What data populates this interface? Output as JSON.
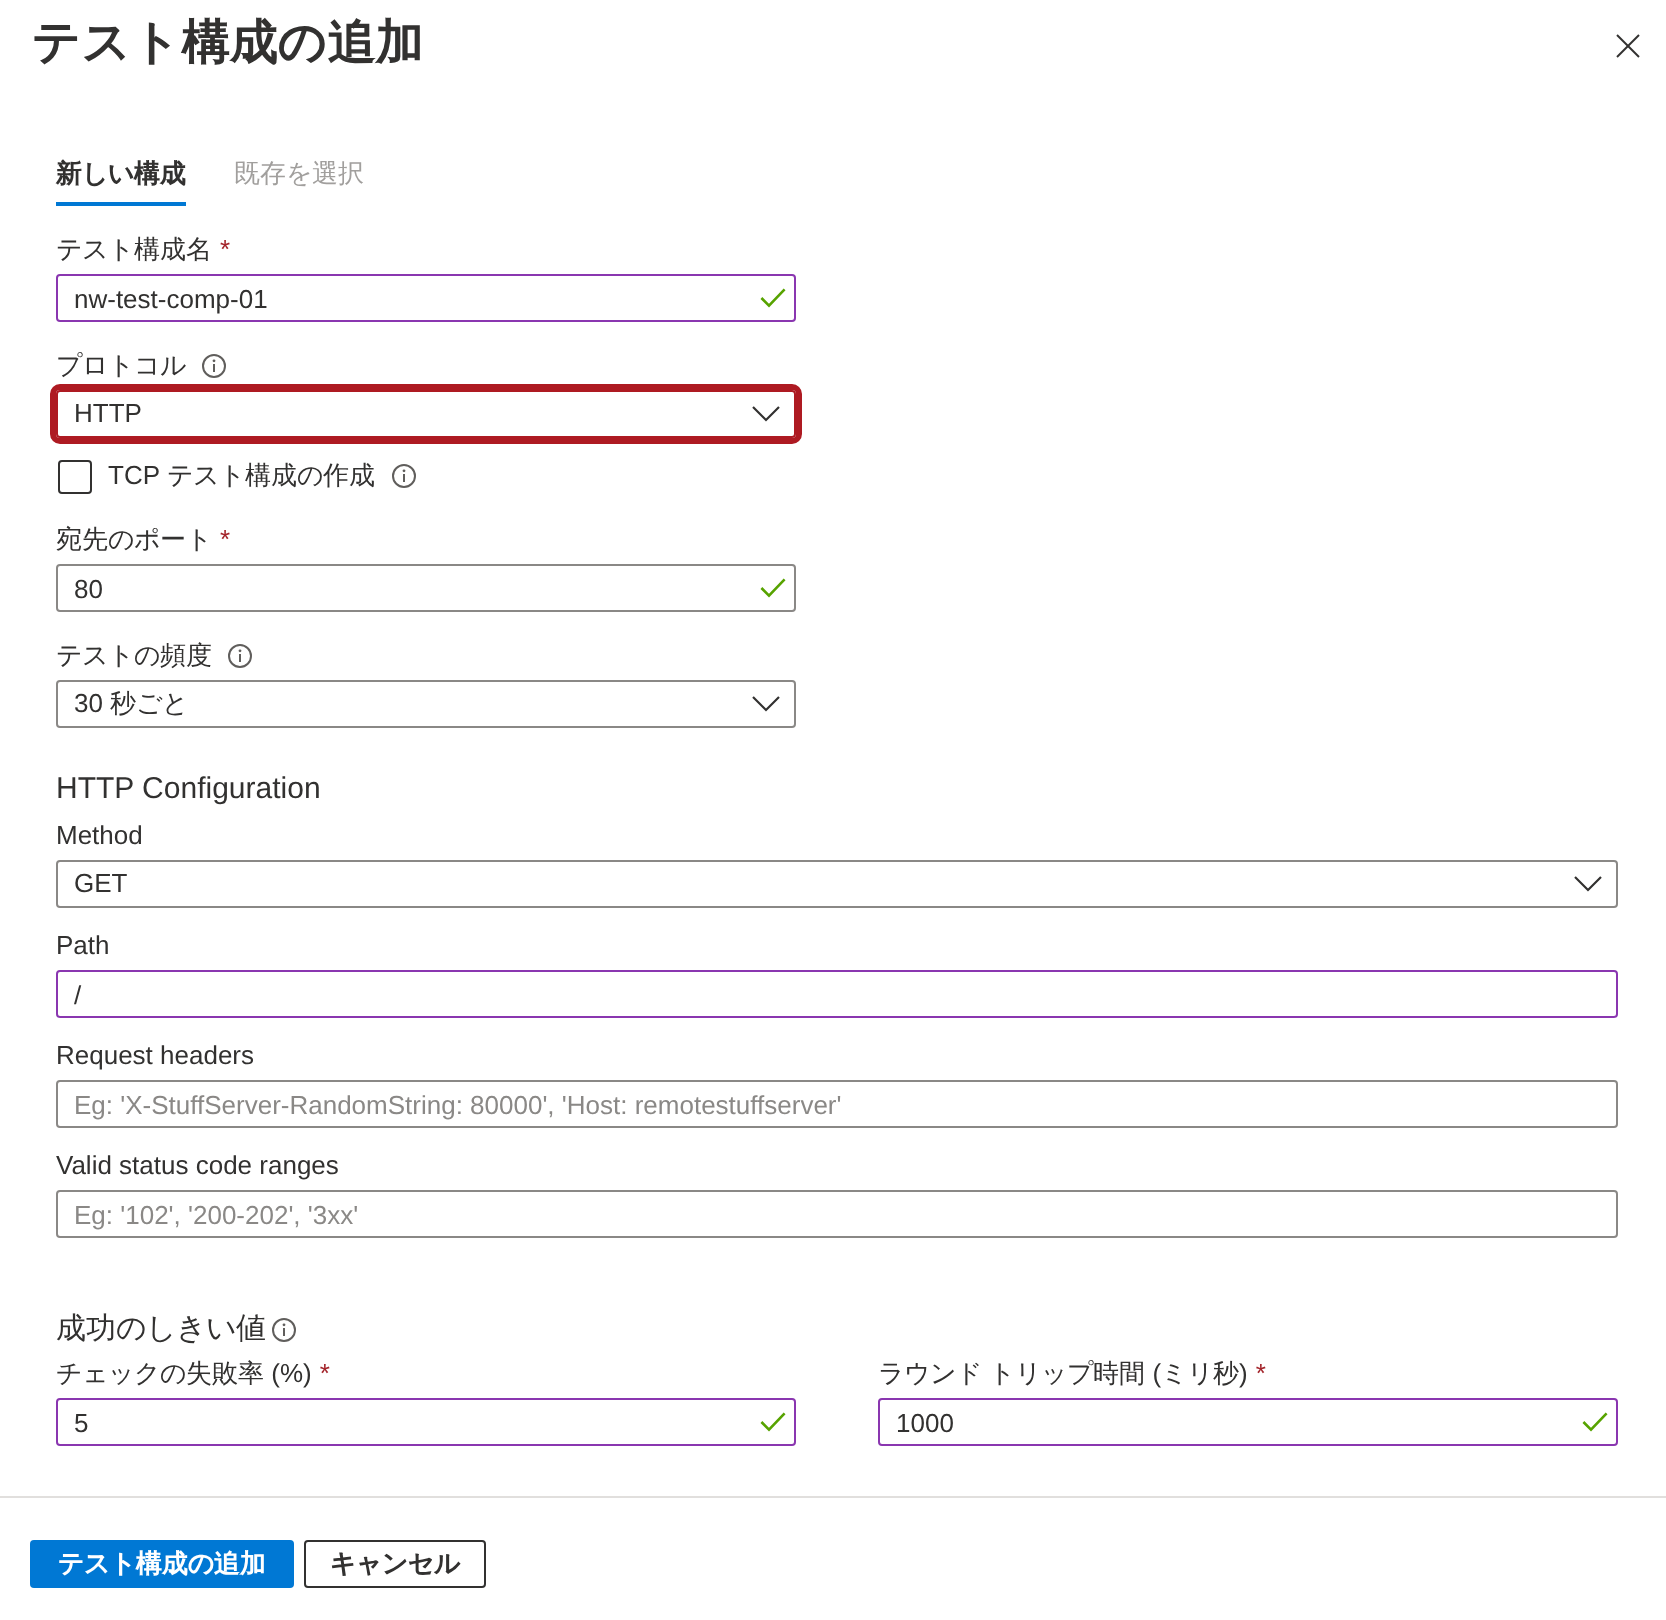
{
  "dialog": {
    "title": "テスト構成の追加"
  },
  "tabs": [
    {
      "label": "新しい構成",
      "selected": true
    },
    {
      "label": "既存を選択",
      "selected": false
    }
  ],
  "fields": [
    {
      "kind": "text",
      "label": "テスト構成名",
      "required_mark": "*",
      "value": "nw-test-comp-01",
      "valid": true,
      "modified": true
    },
    {
      "kind": "select",
      "label": "プロトコル",
      "info": true,
      "value": "HTTP",
      "highlighted": true
    },
    {
      "kind": "checkbox",
      "label": "TCP テスト構成の作成",
      "info": true,
      "checked": false
    },
    {
      "kind": "text",
      "label": "宛先のポート",
      "required_mark": "*",
      "value": "80",
      "valid": true,
      "modified": false
    },
    {
      "kind": "select",
      "label": "テストの頻度",
      "info": true,
      "value": "30 秒ごと",
      "highlighted": false
    }
  ],
  "http_configuration": {
    "heading": "HTTP Configuration",
    "fields": [
      {
        "kind": "select",
        "label": "Method",
        "value": "GET",
        "highlighted": false
      },
      {
        "kind": "text",
        "label": "Path",
        "value": "/",
        "modified": true
      },
      {
        "kind": "text",
        "label": "Request headers",
        "placeholder": "Eg: 'X-StuffServer-RandomString: 80000', 'Host: remotestuffserver'",
        "modified": false
      },
      {
        "kind": "text",
        "label": "Valid status code ranges",
        "placeholder": "Eg: '102', '200-202', '3xx'",
        "modified": false
      }
    ]
  },
  "success_threshold": {
    "heading": "成功のしきい値",
    "info": true,
    "fields": [
      {
        "kind": "text",
        "label": "チェックの失敗率 (%)",
        "required_mark": "*",
        "value": "5",
        "valid": true,
        "modified": true
      },
      {
        "kind": "text",
        "label": "ラウンド トリップ時間 (ミリ秒)",
        "required_mark": "*",
        "value": "1000",
        "valid": true,
        "modified": true
      }
    ]
  },
  "buttons": [
    {
      "kind": "primary",
      "label": "テスト構成の追加"
    },
    {
      "kind": "secondary",
      "label": "キャンセル"
    }
  ]
}
